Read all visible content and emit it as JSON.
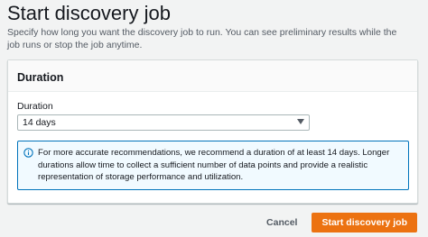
{
  "page": {
    "title": "Start discovery job",
    "description": "Specify how long you want the discovery job to run. You can see preliminary results while the job runs or stop the job anytime."
  },
  "panel": {
    "title": "Duration",
    "field_label": "Duration",
    "select": {
      "selected": "14 days"
    },
    "alert": {
      "icon": "info-icon",
      "text": "For more accurate recommendations, we recommend a duration of at least 14 days. Longer durations allow time to collect a sufficient number of data points and provide a realistic representation of storage performance and utilization."
    }
  },
  "actions": {
    "cancel_label": "Cancel",
    "primary_label": "Start discovery job"
  },
  "colors": {
    "primary": "#ec7211",
    "info_border": "#0073bb",
    "info_background": "#f1faff"
  }
}
